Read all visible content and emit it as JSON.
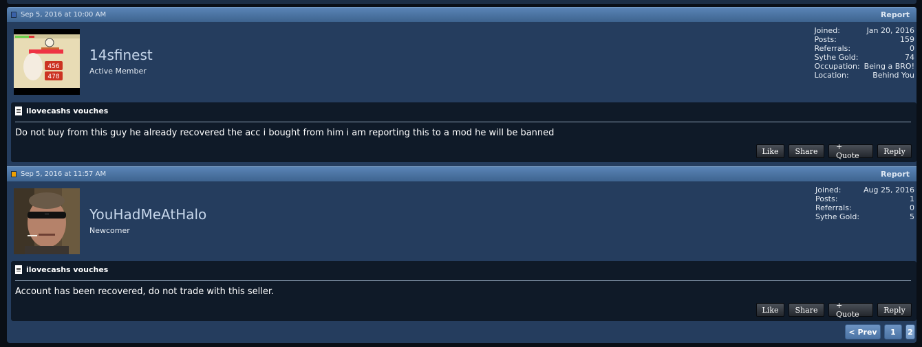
{
  "posts": [
    {
      "date": "Sep 5, 2016 at 10:00 AM",
      "report_label": "Report",
      "username": "14sfinest",
      "user_title": "Active Member",
      "avatar_numbers": [
        "456",
        "478"
      ],
      "info": [
        {
          "label": "Joined:",
          "value": "Jan 20, 2016"
        },
        {
          "label": "Posts:",
          "value": "159"
        },
        {
          "label": "Referrals:",
          "value": "0"
        },
        {
          "label": "Sythe Gold:",
          "value": "74"
        },
        {
          "label": "Occupation:",
          "value": "Being a BRO!"
        },
        {
          "label": "Location:",
          "value": "Behind You"
        }
      ],
      "message_title": "ilovecashs vouches",
      "message": "Do not buy from this guy he already recovered the acc i bought from him i am reporting this to a mod he will be banned"
    },
    {
      "date": "Sep 5, 2016 at 11:57 AM",
      "report_label": "Report",
      "username": "YouHadMeAtHalo",
      "user_title": "Newcomer",
      "info": [
        {
          "label": "Joined:",
          "value": "Aug 25, 2016"
        },
        {
          "label": "Posts:",
          "value": "1"
        },
        {
          "label": "Referrals:",
          "value": "0"
        },
        {
          "label": "Sythe Gold:",
          "value": "5"
        }
      ],
      "message_title": "ilovecashs vouches",
      "message": "Account has been recovered, do not trade with this seller."
    }
  ],
  "actions": {
    "like": "Like",
    "share": "Share",
    "quote": "+ Quote",
    "reply": "Reply"
  },
  "pager": {
    "prev": "< Prev",
    "page1": "1",
    "page2": "2"
  },
  "colors": {
    "header": "#4a74a6",
    "panel": "#253d5e",
    "message_bg": "#0f1a28",
    "new_post_icon": "#f0a000",
    "read_post_icon": "#3a61a8"
  }
}
